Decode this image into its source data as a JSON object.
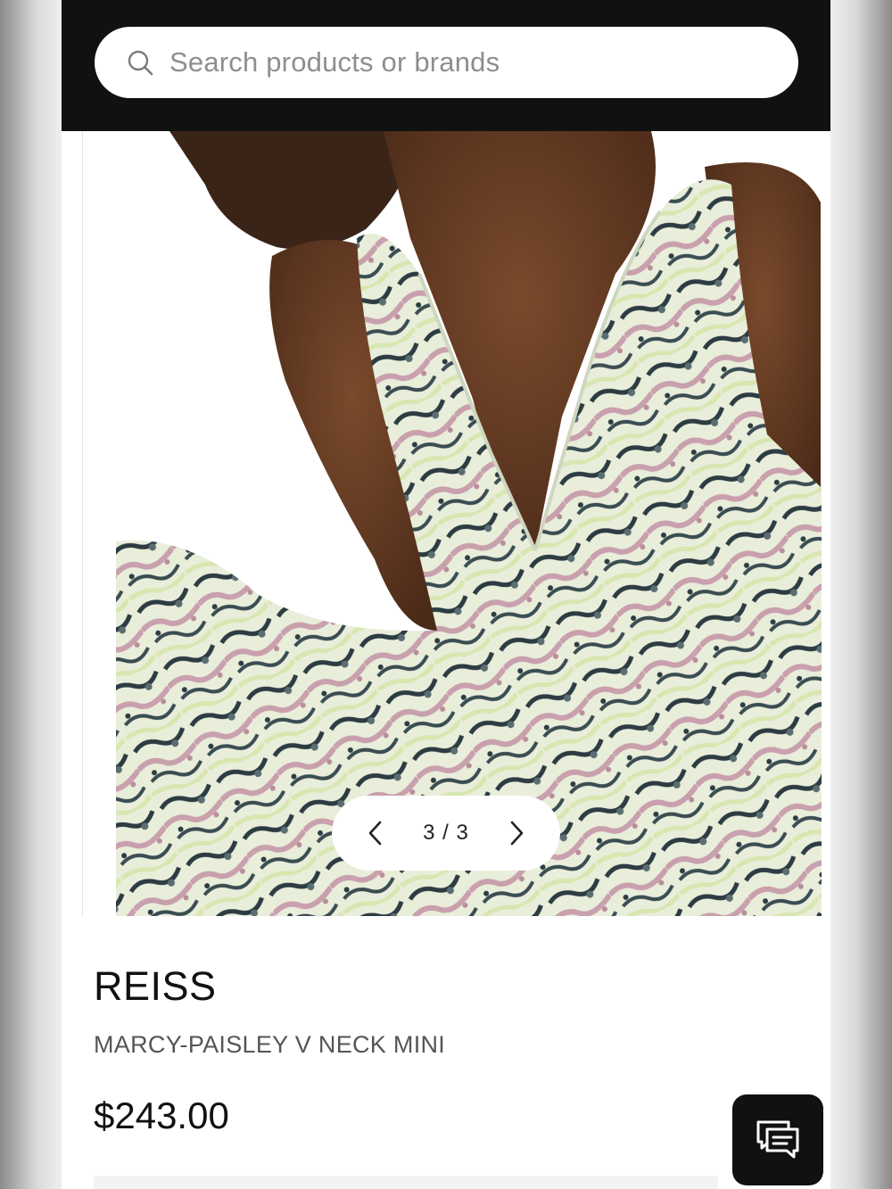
{
  "search": {
    "placeholder": "Search products or brands",
    "icon": "search-icon"
  },
  "gallery": {
    "current_page": 3,
    "total_pages": 3,
    "counter_text": "3 / 3",
    "prev_icon": "chevron-left-icon",
    "next_icon": "chevron-right-icon"
  },
  "product": {
    "brand": "REISS",
    "name": "MARCY-PAISLEY V NECK MINI",
    "price": "$243.00"
  },
  "chat": {
    "icon": "chat-icon"
  },
  "colors": {
    "topbar": "#111111",
    "background": "#ffffff",
    "placeholder_text": "#8e8e8e",
    "price_text": "#111111",
    "chat_button": "#111111"
  }
}
